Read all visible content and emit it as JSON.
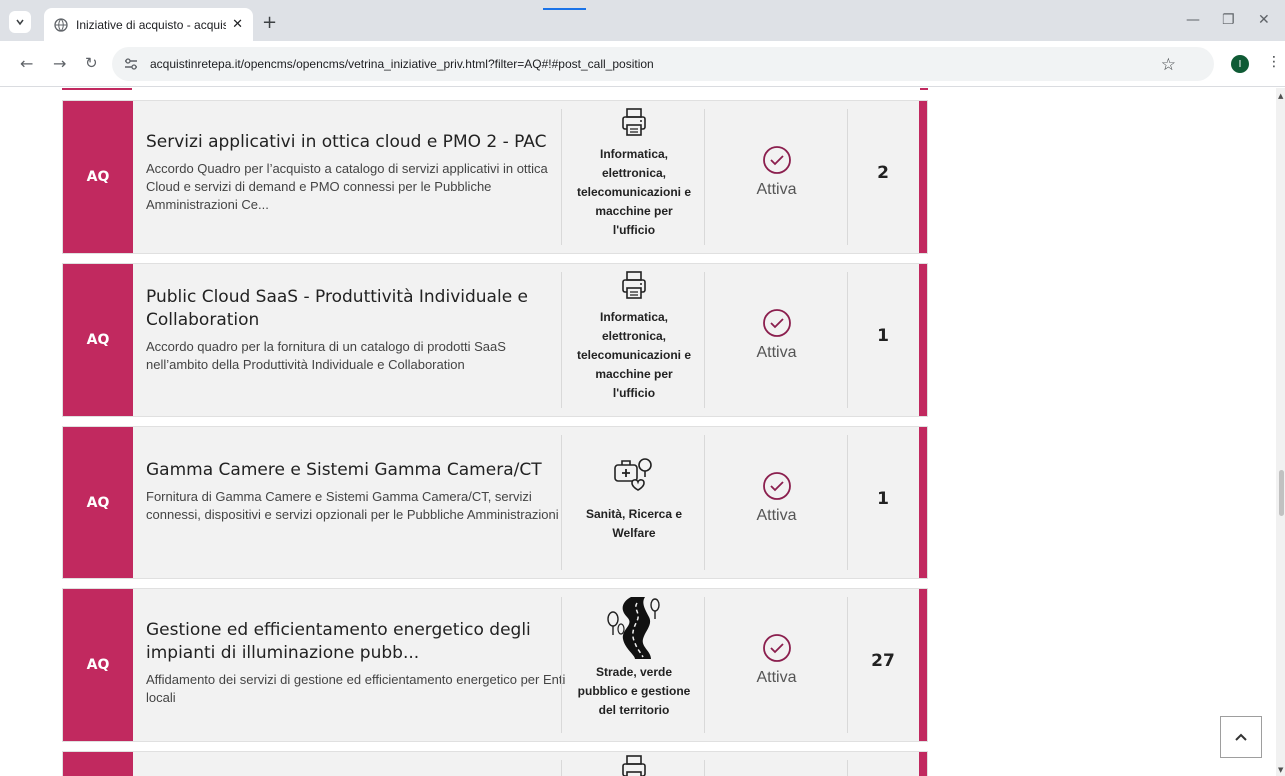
{
  "browser": {
    "tab_title": "Iniziative di acquisto - acquistin",
    "url": "acquistinretepa.it/opencms/opencms/vetrina_iniziative_priv.html?filter=AQ#!#post_call_position",
    "profile_initial": "I",
    "icons": {
      "tab_menu": "chevron-down-icon",
      "favicon": "globe-icon",
      "close": "close-icon",
      "new_tab": "plus-icon",
      "back": "back-arrow-icon",
      "forward": "forward-arrow-icon",
      "reload": "reload-icon",
      "site_info": "tune-icon",
      "bookmark": "star-icon",
      "menu": "kebab-icon",
      "minimize": "minimize-icon",
      "restore": "restore-icon",
      "close_window": "close-window-icon"
    }
  },
  "colors": {
    "accent": "#c1295f",
    "card_bg": "#f2f2f2",
    "status_icon": "#8b1f4e"
  },
  "initiatives": [
    {
      "badge": "AQ",
      "title": "Servizi applicativi in ottica cloud e PMO 2 - PAC",
      "description": "Accordo Quadro per l’acquisto a catalogo di servizi applicativi in ottica Cloud e servizi di demand e PMO connessi per le Pubbliche Amministrazioni Ce...",
      "category": [
        "Informatica,",
        "elettronica,",
        "telecomunicazioni e",
        "macchine per",
        "l'ufficio"
      ],
      "category_icon": "printer-icon",
      "status": "Attiva",
      "count": "2"
    },
    {
      "badge": "AQ",
      "title": "Public Cloud SaaS - Produttività Individuale e Collaboration",
      "description": "Accordo quadro per la fornitura di un catalogo di prodotti SaaS nell’ambito della Produttività Individuale e Collaboration",
      "category": [
        "Informatica,",
        "elettronica,",
        "telecomunicazioni e",
        "macchine per",
        "l'ufficio"
      ],
      "category_icon": "printer-icon",
      "status": "Attiva",
      "count": "1"
    },
    {
      "badge": "AQ",
      "title": "Gamma Camere e Sistemi Gamma Camera/CT",
      "description": "Fornitura di Gamma Camere e Sistemi Gamma Camera/CT, servizi connessi, dispositivi e servizi opzionali per le Pubbliche Amministrazioni",
      "category": [
        "Sanità, Ricerca e",
        "Welfare"
      ],
      "category_icon": "health-icon",
      "status": "Attiva",
      "count": "1"
    },
    {
      "badge": "AQ",
      "title": "Gestione ed efficientamento energetico degli impianti di illuminazione pubb...",
      "description": "Affidamento dei servizi di gestione ed efficientamento energetico per Enti locali",
      "category": [
        "Strade, verde",
        "pubblico e gestione",
        "del territorio"
      ],
      "category_icon": "road-icon",
      "status": "Attiva",
      "count": "27"
    }
  ]
}
